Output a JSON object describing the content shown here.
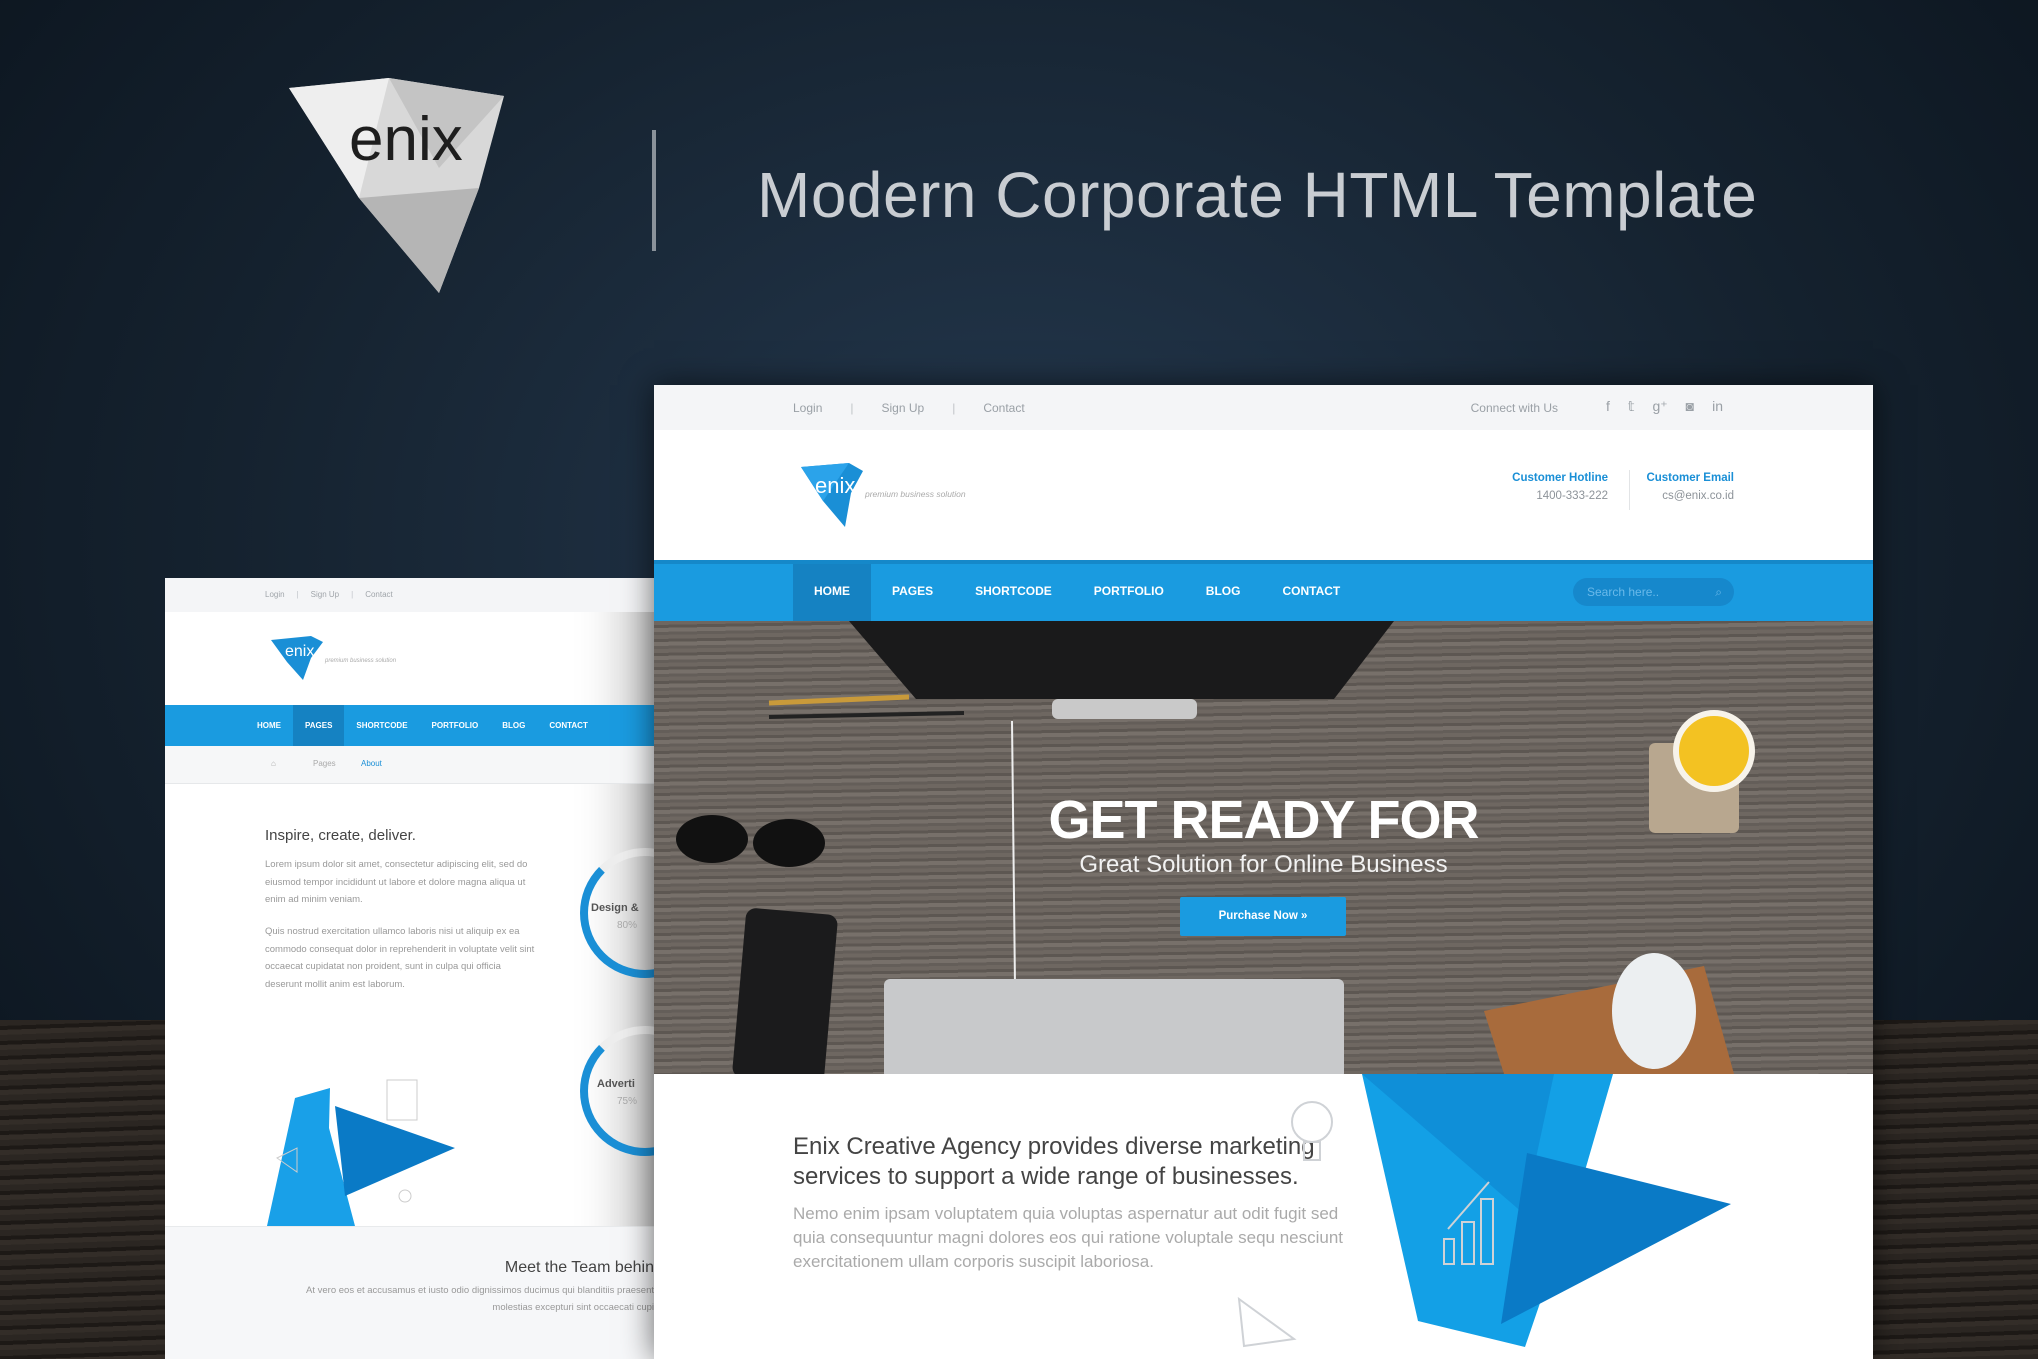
{
  "banner": {
    "logo_text": "enix",
    "headline": "Modern Corporate HTML Template"
  },
  "main": {
    "topbar": {
      "links": [
        "Login",
        "Sign Up",
        "Contact"
      ],
      "connect": "Connect with Us",
      "social_icons": [
        "facebook-icon",
        "twitter-icon",
        "google-plus-icon",
        "instagram-icon",
        "linkedin-icon"
      ]
    },
    "header": {
      "logo_text": "enix",
      "tagline": "premium business solution",
      "hotline_label": "Customer Hotline",
      "hotline": "1400-333-222",
      "email_label": "Customer Email",
      "email": "cs@enix.co.id"
    },
    "nav": {
      "items": [
        "HOME",
        "PAGES",
        "SHORTCODE",
        "PORTFOLIO",
        "BLOG",
        "CONTACT"
      ],
      "active": "HOME",
      "search_placeholder": "Search here.."
    },
    "hero": {
      "title": "GET READY FOR",
      "subtitle": "Great Solution for Online Business",
      "button": "Purchase Now »"
    },
    "about": {
      "heading": "Enix Creative Agency provides diverse marketing services to support a wide range of businesses.",
      "body": "Nemo enim ipsam voluptatem quia voluptas aspernatur aut odit fugit sed quia consequuntur magni dolores eos qui ratione voluptale sequ nesciunt exercitationem ullam corporis suscipit laboriosa."
    }
  },
  "side": {
    "topbar": {
      "links": [
        "Login",
        "Sign Up",
        "Contact"
      ]
    },
    "header": {
      "logo_text": "enix",
      "tagline": "premium business solution"
    },
    "nav": {
      "items": [
        "HOME",
        "PAGES",
        "SHORTCODE",
        "PORTFOLIO",
        "BLOG",
        "CONTACT"
      ],
      "active": "PAGES"
    },
    "breadcrumb": [
      "Pages",
      "About"
    ],
    "heading": "Inspire, create, deliver.",
    "p1": "Lorem ipsum dolor sit amet, consectetur adipiscing elit, sed do eiusmod tempor incididunt ut labore et dolore magna aliqua ut enim ad minim veniam.",
    "p2": "Quis nostrud exercitation ullamco laboris nisi ut aliquip ex ea commodo consequat dolor in reprehenderit in voluptate velit sint occaecat cupidatat non proident, sunt in culpa qui officia deserunt mollit anim est laborum.",
    "skills": [
      {
        "label": "Design &",
        "value": "80%"
      },
      {
        "label": "Adverti",
        "value": "75%"
      }
    ],
    "team_heading": "Meet the Team behin",
    "team_text1": "At vero eos et accusamus et iusto odio dignissimos ducimus qui blanditiis praesent",
    "team_text2": "molestias excepturi sint occaecati cupi"
  },
  "colors": {
    "accent": "#1a9be0",
    "accent_dark": "#1582c2",
    "background": "#15222f"
  }
}
